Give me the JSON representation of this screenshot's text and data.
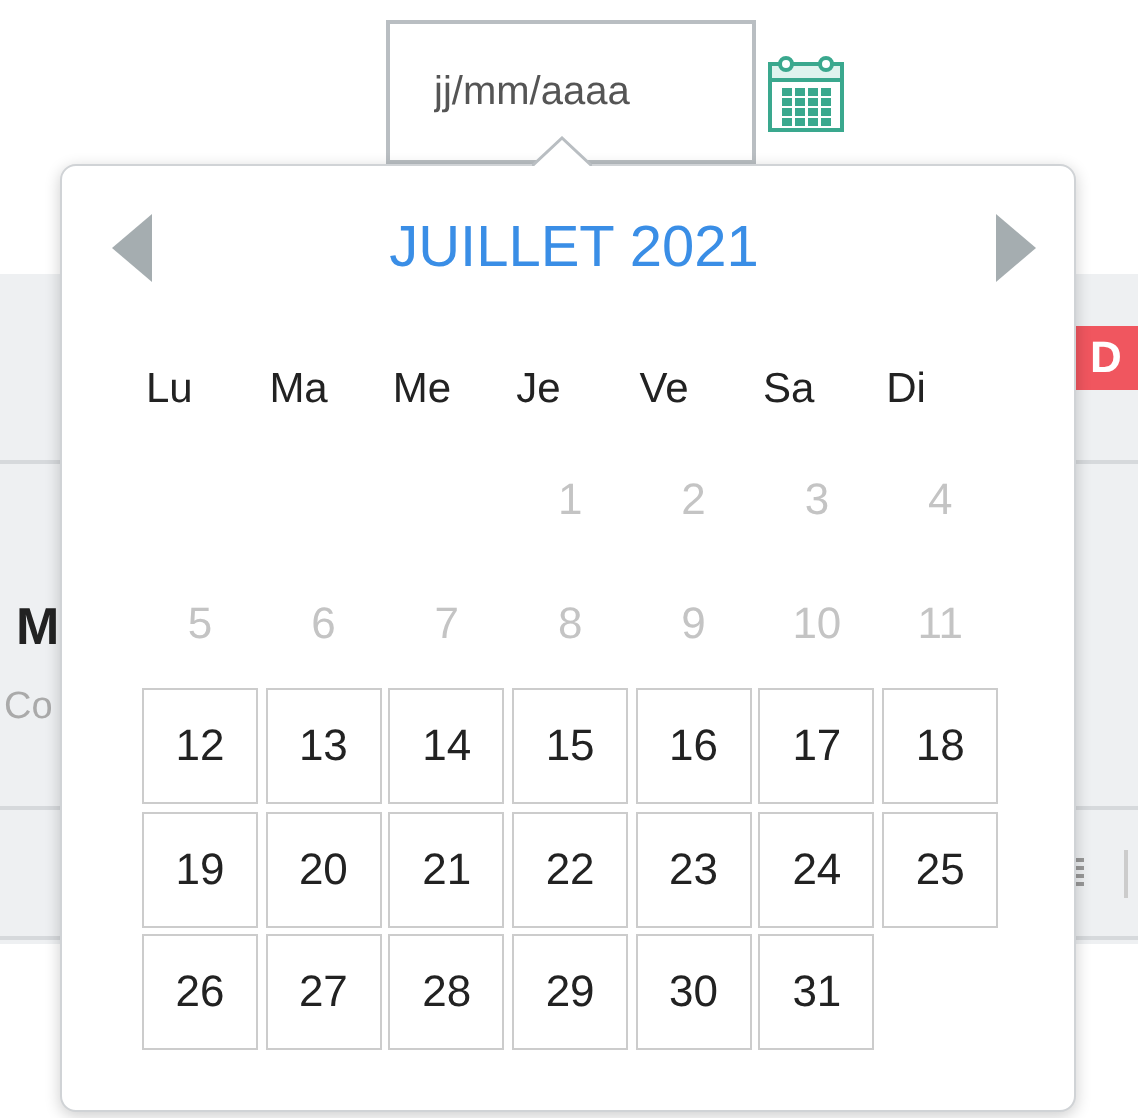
{
  "date_field": {
    "placeholder": "jj/mm/aaaa"
  },
  "background": {
    "badge": "D",
    "heading": "M",
    "subtitle": "Co"
  },
  "calendar": {
    "month": "JUILLET 2021",
    "weekdays": [
      "Lu",
      "Ma",
      "Me",
      "Je",
      "Ve",
      "Sa",
      "Di"
    ],
    "weeks": [
      [
        {
          "kind": "empty"
        },
        {
          "kind": "empty"
        },
        {
          "kind": "empty"
        },
        {
          "kind": "day",
          "label": "1",
          "disabled": true
        },
        {
          "kind": "day",
          "label": "2",
          "disabled": true
        },
        {
          "kind": "day",
          "label": "3",
          "disabled": true
        },
        {
          "kind": "day",
          "label": "4",
          "disabled": true
        }
      ],
      [
        {
          "kind": "day",
          "label": "5",
          "disabled": true
        },
        {
          "kind": "day",
          "label": "6",
          "disabled": true
        },
        {
          "kind": "day",
          "label": "7",
          "disabled": true
        },
        {
          "kind": "day",
          "label": "8",
          "disabled": true
        },
        {
          "kind": "day",
          "label": "9",
          "disabled": true
        },
        {
          "kind": "day",
          "label": "10",
          "disabled": true
        },
        {
          "kind": "day",
          "label": "11",
          "disabled": true
        }
      ],
      [
        {
          "kind": "day",
          "label": "12",
          "disabled": false
        },
        {
          "kind": "day",
          "label": "13",
          "disabled": false
        },
        {
          "kind": "day",
          "label": "14",
          "disabled": false
        },
        {
          "kind": "day",
          "label": "15",
          "disabled": false
        },
        {
          "kind": "day",
          "label": "16",
          "disabled": false
        },
        {
          "kind": "day",
          "label": "17",
          "disabled": false
        },
        {
          "kind": "day",
          "label": "18",
          "disabled": false
        }
      ],
      [
        {
          "kind": "day",
          "label": "19",
          "disabled": false
        },
        {
          "kind": "day",
          "label": "20",
          "disabled": false
        },
        {
          "kind": "day",
          "label": "21",
          "disabled": false
        },
        {
          "kind": "day",
          "label": "22",
          "disabled": false
        },
        {
          "kind": "day",
          "label": "23",
          "disabled": false
        },
        {
          "kind": "day",
          "label": "24",
          "disabled": false
        },
        {
          "kind": "day",
          "label": "25",
          "disabled": false
        }
      ],
      [
        {
          "kind": "day",
          "label": "26",
          "disabled": false
        },
        {
          "kind": "day",
          "label": "27",
          "disabled": false
        },
        {
          "kind": "day",
          "label": "28",
          "disabled": false
        },
        {
          "kind": "day",
          "label": "29",
          "disabled": false
        },
        {
          "kind": "day",
          "label": "30",
          "disabled": false
        },
        {
          "kind": "day",
          "label": "31",
          "disabled": false
        },
        {
          "kind": "empty"
        }
      ]
    ]
  }
}
